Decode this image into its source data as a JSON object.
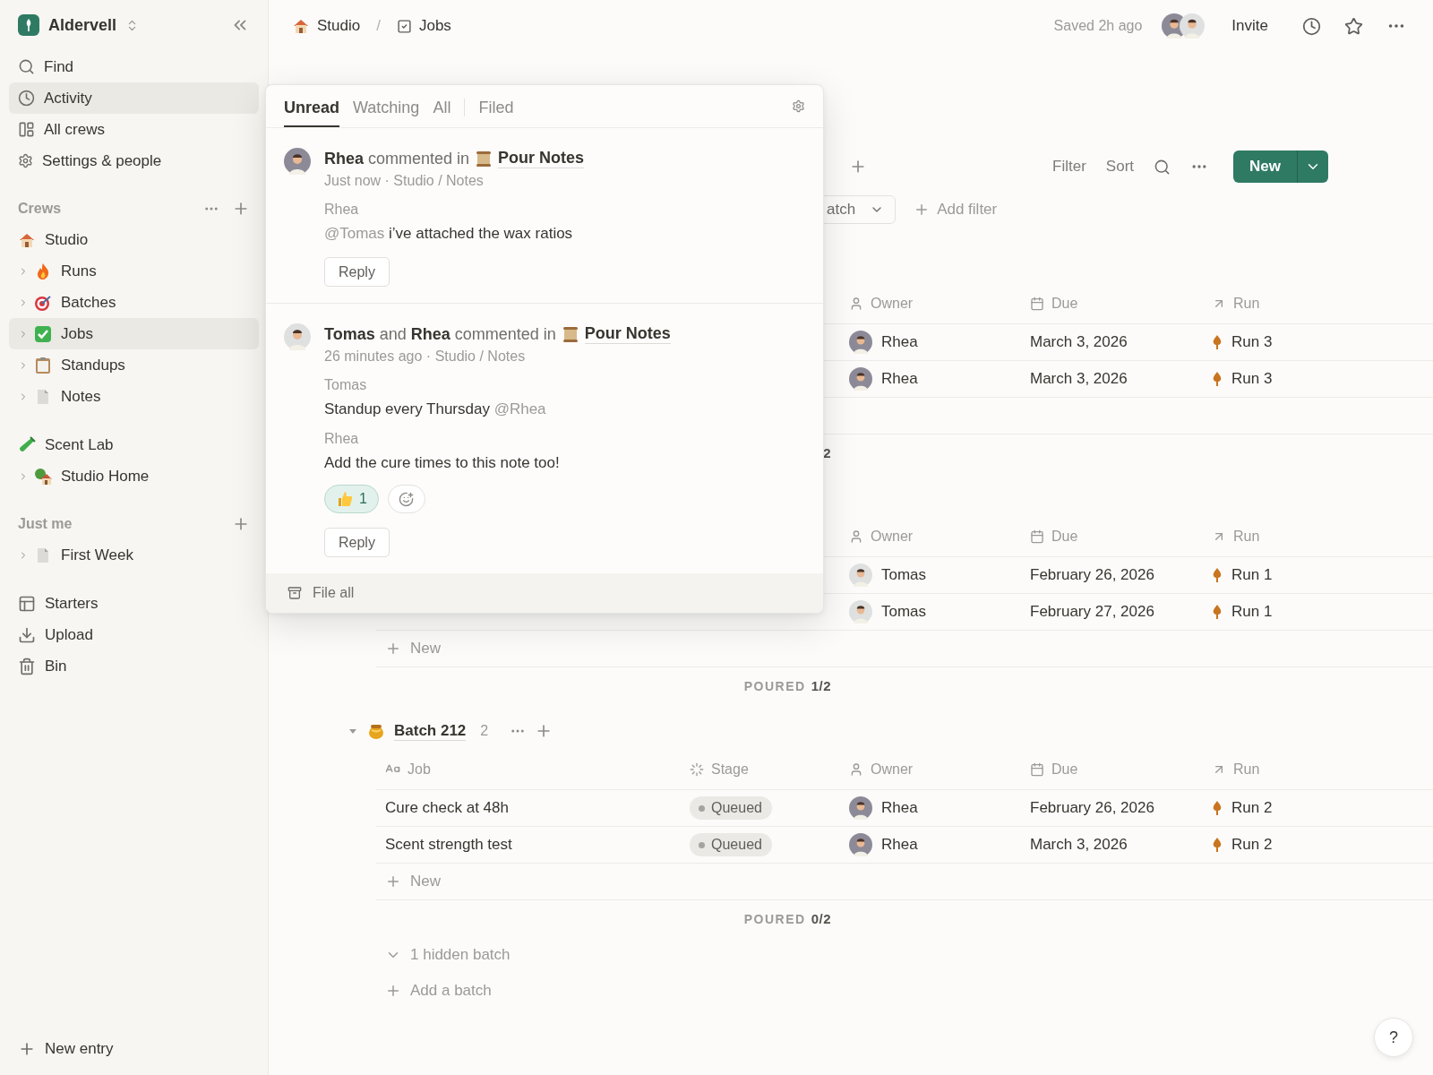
{
  "sidebar": {
    "workspace": "Aldervell",
    "nav": [
      {
        "label": "Find",
        "selected": false
      },
      {
        "label": "Activity",
        "selected": true
      },
      {
        "label": "All crews",
        "selected": false
      },
      {
        "label": "Settings & people",
        "selected": false
      }
    ],
    "sections": [
      {
        "title": "Crews",
        "more": true,
        "add": true,
        "items": [
          {
            "label": "Studio",
            "expandable": false,
            "selected": false
          },
          {
            "label": "Runs",
            "expandable": true,
            "selected": false
          },
          {
            "label": "Batches",
            "expandable": true,
            "selected": false
          },
          {
            "label": "Jobs",
            "expandable": true,
            "selected": true
          },
          {
            "label": "Standups",
            "expandable": true,
            "selected": false
          },
          {
            "label": "Notes",
            "expandable": true,
            "selected": false
          }
        ]
      },
      {
        "items": [
          {
            "label": "Scent Lab",
            "expandable": false,
            "selected": false
          },
          {
            "label": "Studio Home",
            "expandable": true,
            "selected": false
          }
        ]
      },
      {
        "title": "Just me",
        "add": true,
        "items": [
          {
            "label": "First Week",
            "expandable": true,
            "selected": false
          }
        ]
      },
      {
        "items": [
          {
            "label": "Starters",
            "expandable": false,
            "selected": false
          },
          {
            "label": "Upload",
            "expandable": false,
            "selected": false
          },
          {
            "label": "Bin",
            "expandable": false,
            "selected": false
          }
        ]
      }
    ],
    "new_entry": "New entry"
  },
  "topbar": {
    "breadcrumbs": [
      "Studio",
      "Jobs"
    ],
    "separator": "/",
    "saved": "Saved 2h ago",
    "invite": "Invite"
  },
  "toolbar": {
    "filter": "Filter",
    "sort": "Sort",
    "new": "New"
  },
  "filters": {
    "chip": "atch",
    "add_filter": "Add filter"
  },
  "groups": [
    {
      "columns": [
        {
          "kind": "owner",
          "label": "Owner"
        },
        {
          "kind": "due",
          "label": "Due"
        },
        {
          "kind": "run",
          "label": "Run"
        }
      ],
      "rows": [
        {
          "owner": {
            "name": "Rhea",
            "color": "#8d8a98"
          },
          "due": "March 3, 2026",
          "run": "Run 3"
        },
        {
          "owner": {
            "name": "Rhea",
            "color": "#8d8a98"
          },
          "due": "March 3, 2026",
          "run": "Run 3"
        }
      ],
      "footer_value": "2"
    },
    {
      "columns": [
        {
          "kind": "owner",
          "label": "Owner"
        },
        {
          "kind": "due",
          "label": "Due"
        },
        {
          "kind": "run",
          "label": "Run"
        }
      ],
      "rows": [
        {
          "owner": {
            "name": "Tomas",
            "color": "#dfe1e1"
          },
          "due": "February 26, 2026",
          "run": "Run 1"
        },
        {
          "owner": {
            "name": "Tomas",
            "color": "#dfe1e1"
          },
          "due": "February 27, 2026",
          "run": "Run 1"
        }
      ],
      "new_label": "New",
      "footer_label": "POURED",
      "footer_value": "1/2"
    },
    {
      "name": "Batch 212",
      "count": "2",
      "expanded": true,
      "columns": [
        {
          "kind": "job",
          "label": "Job"
        },
        {
          "kind": "stage",
          "label": "Stage"
        },
        {
          "kind": "owner",
          "label": "Owner"
        },
        {
          "kind": "due",
          "label": "Due"
        },
        {
          "kind": "run",
          "label": "Run"
        }
      ],
      "rows": [
        {
          "job": "Cure check at 48h",
          "stage": "Queued",
          "owner": {
            "name": "Rhea",
            "color": "#8d8a98"
          },
          "due": "February 26, 2026",
          "run": "Run 2"
        },
        {
          "job": "Scent strength test",
          "stage": "Queued",
          "owner": {
            "name": "Rhea",
            "color": "#8d8a98"
          },
          "due": "March 3, 2026",
          "run": "Run 2"
        }
      ],
      "new_label": "New",
      "footer_label": "POURED",
      "footer_value": "0/2"
    }
  ],
  "hidden_batches": "1 hidden batch",
  "add_batch": "Add a batch",
  "help": "?",
  "activity": {
    "tabs": [
      {
        "label": "Unread",
        "selected": true,
        "separated": false
      },
      {
        "label": "Watching",
        "selected": false,
        "separated": false
      },
      {
        "label": "All",
        "selected": false,
        "separated": false
      },
      {
        "label": "Filed",
        "selected": false,
        "separated": true
      }
    ],
    "notifications": [
      {
        "avatar": {
          "color": "#8d8a98"
        },
        "title": "**Rhea** commented in",
        "page": "Pour Notes",
        "meta": "Just now · Studio / Notes",
        "comments": [
          {
            "author": "Rhea",
            "parts": [
              {
                "kind": "mention",
                "text": "@Tomas"
              },
              {
                "kind": "plain",
                "text": "i’ve attached the wax ratios"
              }
            ]
          }
        ],
        "reply": "Reply"
      },
      {
        "avatar": {
          "color": "#dfe1e1"
        },
        "title": "**Tomas** and **Rhea** commented in",
        "page": "Pour Notes",
        "meta": "26 minutes ago · Studio / Notes",
        "comments": [
          {
            "author": "Tomas",
            "parts": [
              {
                "kind": "plain",
                "text": "Standup every Thursday"
              },
              {
                "kind": "mention",
                "text": "@Rhea"
              }
            ]
          },
          {
            "author": "Rhea",
            "parts": [
              {
                "kind": "plain",
                "text": "Add the cure times to this note too!"
              }
            ]
          }
        ],
        "reactions": [
          {
            "count": "1",
            "selected": true
          }
        ],
        "reply": "Reply"
      }
    ],
    "file_all": "File all"
  }
}
